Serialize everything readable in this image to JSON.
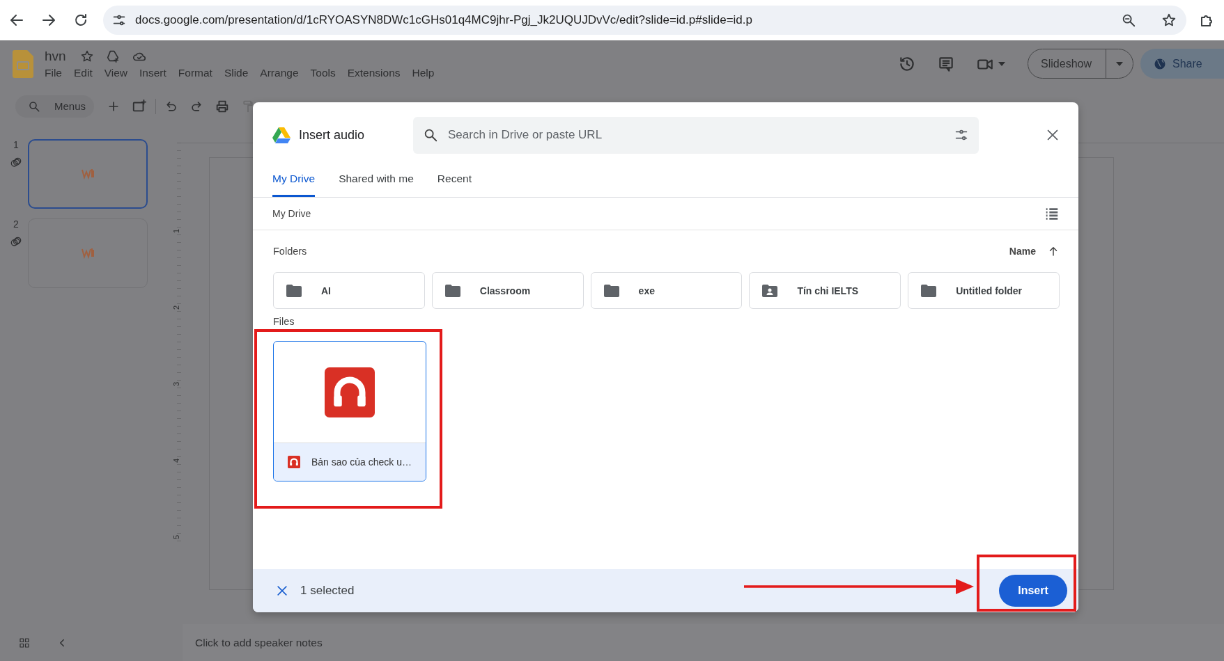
{
  "browser": {
    "url": "docs.google.com/presentation/d/1cRYOASYN8DWc1cGHs01q4MC9jhr-Pgj_Jk2UQUJDvVc/edit?slide=id.p#slide=id.p"
  },
  "app": {
    "title": "hvn",
    "menus": [
      "File",
      "Edit",
      "View",
      "Insert",
      "Format",
      "Slide",
      "Arrange",
      "Tools",
      "Extensions",
      "Help"
    ],
    "search_label": "Menus",
    "slideshow_label": "Slideshow",
    "share_label": "Share"
  },
  "slides": [
    {
      "number": "1",
      "selected": true
    },
    {
      "number": "2",
      "selected": false
    }
  ],
  "ruler": [
    "1",
    "2",
    "3",
    "4",
    "5"
  ],
  "speaker_notes": "Click to add speaker notes",
  "dialog": {
    "title": "Insert audio",
    "search_placeholder": "Search in Drive or paste URL",
    "tabs": [
      {
        "label": "My Drive",
        "selected": true
      },
      {
        "label": "Shared with me",
        "selected": false
      },
      {
        "label": "Recent",
        "selected": false
      }
    ],
    "breadcrumb": "My Drive",
    "folders_label": "Folders",
    "sort_label": "Name",
    "folders": [
      {
        "name": "AI",
        "kind": "folder"
      },
      {
        "name": "Classroom",
        "kind": "folder"
      },
      {
        "name": "exe",
        "kind": "folder"
      },
      {
        "name": "Tín chỉ IELTS",
        "kind": "shared"
      },
      {
        "name": "Untitled folder",
        "kind": "folder"
      }
    ],
    "files_label": "Files",
    "files": [
      {
        "name": "Bản sao của check u…",
        "selected": true
      }
    ],
    "selection_count": "1 selected",
    "insert_label": "Insert"
  },
  "annotations": [
    {
      "kind": "box"
    },
    {
      "kind": "arrow"
    },
    {
      "kind": "box"
    }
  ]
}
